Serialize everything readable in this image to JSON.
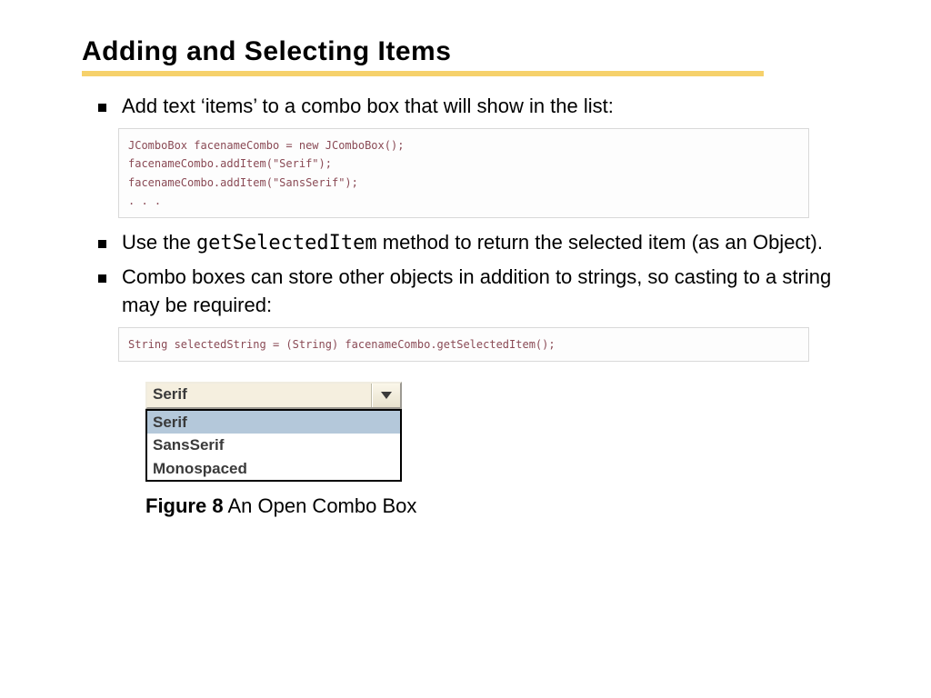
{
  "title": "Adding and Selecting Items",
  "bullets": {
    "b1": "Add text ‘items’ to a combo box that will show in the  list:",
    "b2a": "Use the ",
    "b2method": "getSelectedItem",
    "b2b": " method to return the selected item (as an Object).",
    "b3": "Combo boxes can store other objects in addition to strings, so casting to a string may be required:"
  },
  "code1": "JComboBox facenameCombo = new JComboBox();\nfacenameCombo.addItem(\"Serif\");\nfacenameCombo.addItem(\"SansSerif\");\n. . .",
  "code2": "String selectedString = (String) facenameCombo.getSelectedItem();",
  "combo": {
    "selected": "Serif",
    "options": [
      "Serif",
      "SansSerif",
      "Monospaced"
    ]
  },
  "figure_label": "Figure 8",
  "figure_caption": " An Open Combo Box"
}
